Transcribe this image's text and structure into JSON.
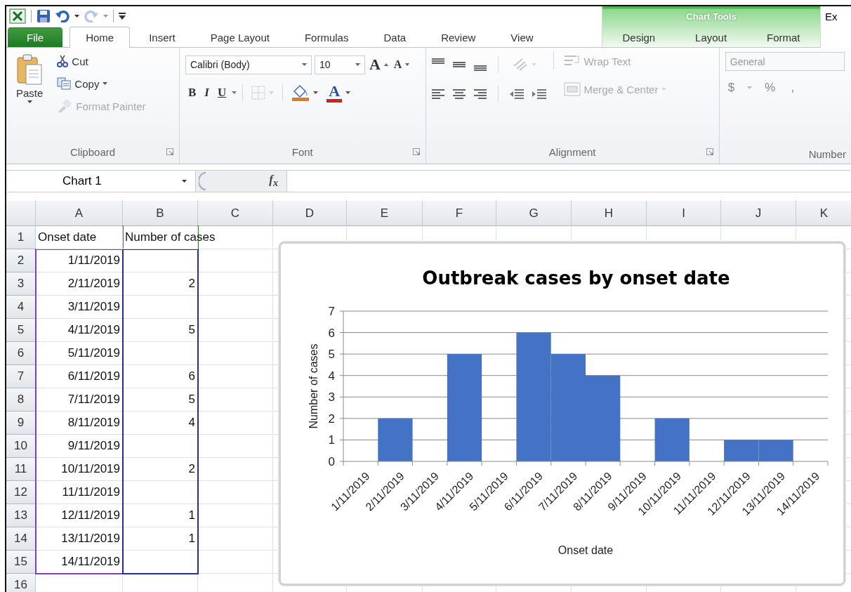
{
  "window": {
    "title": "Ex"
  },
  "quick_access": {
    "undo": {
      "disabled": false
    },
    "redo": {
      "disabled": true
    }
  },
  "context_group": {
    "label": "Chart Tools"
  },
  "tabs": [
    {
      "label": "File",
      "kind": "file",
      "selected": false
    },
    {
      "label": "Home",
      "kind": "plain",
      "selected": true
    },
    {
      "label": "Insert",
      "kind": "plain",
      "selected": false
    },
    {
      "label": "Page Layout",
      "kind": "plain",
      "selected": false
    },
    {
      "label": "Formulas",
      "kind": "plain",
      "selected": false
    },
    {
      "label": "Data",
      "kind": "plain",
      "selected": false
    },
    {
      "label": "Review",
      "kind": "plain",
      "selected": false
    },
    {
      "label": "View",
      "kind": "plain",
      "selected": false
    },
    {
      "label": "Design",
      "kind": "context",
      "selected": false
    },
    {
      "label": "Layout",
      "kind": "context",
      "selected": false
    },
    {
      "label": "Format",
      "kind": "context",
      "selected": false
    }
  ],
  "ribbon": {
    "clipboard": {
      "label": "Clipboard",
      "paste": {
        "label": "Paste",
        "disabled": false
      },
      "cut": {
        "label": "Cut",
        "disabled": false
      },
      "copy": {
        "label": "Copy",
        "disabled": false
      },
      "format_painter": {
        "label": "Format Painter",
        "disabled": true
      }
    },
    "font": {
      "label": "Font",
      "font_name": "Calibri (Body)",
      "font_size": "10",
      "grow": "A",
      "shrink": "A",
      "styles": [
        "B",
        "I",
        "U"
      ],
      "borders": {
        "disabled": true
      },
      "font_color": "A"
    },
    "alignment": {
      "label": "Alignment",
      "wrap_text": {
        "label": "Wrap Text",
        "disabled": true
      },
      "merge_center": {
        "label": "Merge & Center",
        "disabled": true
      }
    },
    "number": {
      "label": "Number",
      "format": {
        "value": "General",
        "disabled": true
      },
      "symbols": [
        "$",
        "%",
        ","
      ]
    }
  },
  "formula_bar": {
    "name_box": "Chart 1",
    "function_label": "f$_{x}$"
  },
  "sheet": {
    "range_outlines": [
      {
        "kind": "categories",
        "color": "#7f3fbf"
      },
      {
        "kind": "values",
        "color": "#1f2fa0"
      },
      {
        "kind": "series_name",
        "color": "#2e8b3a"
      }
    ],
    "columns": [
      {
        "label": "A"
      },
      {
        "label": "B"
      },
      {
        "label": "C"
      },
      {
        "label": "D"
      },
      {
        "label": "E"
      },
      {
        "label": "F"
      },
      {
        "label": "G"
      },
      {
        "label": "H"
      },
      {
        "label": "I"
      },
      {
        "label": "J"
      },
      {
        "label": "K"
      }
    ],
    "rows": [
      {
        "label": "1",
        "kind": "header",
        "cells": [
          "Onset date",
          "Number of cases"
        ]
      },
      {
        "label": "2",
        "kind": "data",
        "cells": [
          "1/11/2019"
        ]
      },
      {
        "label": "3",
        "kind": "data",
        "cells": [
          "2/11/2019",
          "2"
        ]
      },
      {
        "label": "4",
        "kind": "data",
        "cells": [
          "3/11/2019"
        ]
      },
      {
        "label": "5",
        "kind": "data",
        "cells": [
          "4/11/2019",
          "5"
        ]
      },
      {
        "label": "6",
        "kind": "data",
        "cells": [
          "5/11/2019"
        ]
      },
      {
        "label": "7",
        "kind": "data",
        "cells": [
          "6/11/2019",
          "6"
        ]
      },
      {
        "label": "8",
        "kind": "data",
        "cells": [
          "7/11/2019",
          "5"
        ]
      },
      {
        "label": "9",
        "kind": "data",
        "cells": [
          "8/11/2019",
          "4"
        ]
      },
      {
        "label": "10",
        "kind": "data",
        "cells": [
          "9/11/2019"
        ]
      },
      {
        "label": "11",
        "kind": "data",
        "cells": [
          "10/11/2019",
          "2"
        ]
      },
      {
        "label": "12",
        "kind": "data",
        "cells": [
          "11/11/2019"
        ]
      },
      {
        "label": "13",
        "kind": "data",
        "cells": [
          "12/11/2019",
          "1"
        ]
      },
      {
        "label": "14",
        "kind": "data",
        "cells": [
          "13/11/2019",
          "1"
        ]
      },
      {
        "label": "15",
        "kind": "data",
        "cells": [
          "14/11/2019"
        ]
      },
      {
        "label": "16",
        "kind": "data"
      }
    ]
  },
  "chart": {
    "chart_data": {
      "type": "bar",
      "title": "Outbreak cases by onset date",
      "xlabel": "Onset date",
      "ylabel": "Number of cases",
      "categories": [
        "1/11/2019",
        "2/11/2019",
        "3/11/2019",
        "4/11/2019",
        "5/11/2019",
        "6/11/2019",
        "7/11/2019",
        "8/11/2019",
        "9/11/2019",
        "10/11/2019",
        "11/11/2019",
        "12/11/2019",
        "13/11/2019",
        "14/11/2019"
      ],
      "values": [
        null,
        2,
        null,
        5,
        null,
        6,
        5,
        4,
        null,
        2,
        null,
        1,
        1,
        null
      ],
      "grid": true,
      "ylim": [
        0,
        7
      ],
      "yticks": [
        0,
        1,
        2,
        3,
        4,
        5,
        6,
        7
      ]
    }
  }
}
